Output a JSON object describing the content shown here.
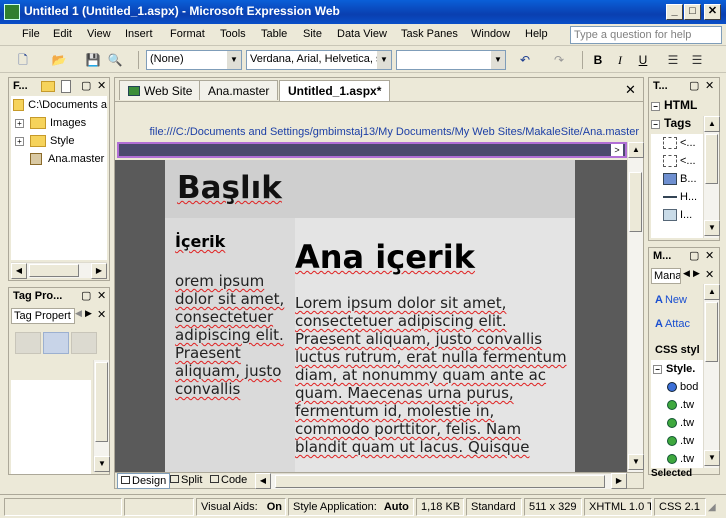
{
  "window": {
    "title": "Untitled 1 (Untitled_1.aspx) - Microsoft Expression Web"
  },
  "caption_buttons": {
    "minimize": "_",
    "maximize": "□",
    "close": "✕"
  },
  "menu": {
    "items": [
      "File",
      "Edit",
      "View",
      "Insert",
      "Format",
      "Tools",
      "Table",
      "Site",
      "Data View",
      "Task Panes",
      "Window",
      "Help"
    ]
  },
  "help_search": {
    "placeholder": "Type a question for help"
  },
  "toolbar": {
    "style_value": "(None)",
    "font_value": "Verdana, Arial, Helvetica, s",
    "size_value": "",
    "bold": "B",
    "italic": "I",
    "underline": "U"
  },
  "folder_list": {
    "title": "F...",
    "root": "C:\\Documents a",
    "items": [
      "Images",
      "Style",
      "Ana.master"
    ]
  },
  "tag_properties": {
    "title": "Tag Pro...",
    "tab": "Tag Propert"
  },
  "editor": {
    "tabs": [
      "Web Site",
      "Ana.master",
      "Untitled_1.aspx*"
    ],
    "path": "file:///C:/Documents and Settings/gmbimstaj13/My Documents/My Web Sites/MakaleSite/Ana.master",
    "page": {
      "header": "Başlık",
      "sidebar_heading": "İçerik",
      "sidebar_text": "orem ipsum dolor sit amet, consectetuer adipiscing elit. Praesent aliquam, justo convallis",
      "main_heading": "Ana içerik",
      "main_text": "Lorem ipsum dolor sit amet, consectetuer adipiscing elit. Praesent aliquam, justo convallis luctus rutrum, erat nulla fermentum diam, at nonummy quam ante ac quam. Maecenas urna purus, fermentum id, molestie in, commodo porttitor, felis. Nam blandit quam ut lacus. Quisque"
    },
    "view_tabs": [
      "Design",
      "Split",
      "Code"
    ]
  },
  "toolbox": {
    "title": "T...",
    "sections": [
      "HTML",
      "Tags"
    ],
    "items": [
      "<...",
      "<...",
      "B...",
      "H...",
      "I..."
    ]
  },
  "manage_styles": {
    "title": "M...",
    "tab": "Mana",
    "new_label": "New",
    "attach_label": "Attac",
    "css_heading": "CSS styl",
    "style_file": "Style.",
    "rules": [
      "bod",
      ".tw",
      ".tw",
      ".tw",
      ".tw"
    ],
    "selected": "Selected"
  },
  "statusbar": {
    "visual_aids_label": "Visual Aids:",
    "visual_aids_value": "On",
    "style_app_label": "Style Application:",
    "style_app_value": "Auto",
    "size": "1,18 KB",
    "mode": "Standard",
    "dimensions": "511 x 329",
    "doctype": "XHTML 1.0 T",
    "css": "CSS 2.1"
  }
}
